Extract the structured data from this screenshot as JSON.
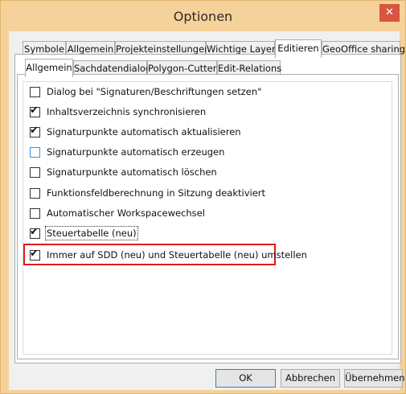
{
  "window": {
    "title": "Optionen",
    "close_glyph": "✕"
  },
  "tabs_top": [
    "Symbole",
    "Allgemein",
    "Projekteinstellungen",
    "Wichtige Layer",
    "Editieren",
    "GeoOffice sharing"
  ],
  "tabs_top_selected": "Editieren",
  "tabs_sub": [
    "Allgemein",
    "Sachdatendialog",
    "Polygon-Cutter",
    "Edit-Relations"
  ],
  "tabs_sub_selected": "Allgemein",
  "options": [
    {
      "label": "Dialog bei \"Signaturen/Beschriftungen setzen\"",
      "checked": false
    },
    {
      "label": "Inhaltsverzeichnis synchronisieren",
      "checked": true
    },
    {
      "label": "Signaturpunkte automatisch aktualisieren",
      "checked": true
    },
    {
      "label": "Signaturpunkte automatisch erzeugen",
      "checked": false
    },
    {
      "label": "Signaturpunkte automatisch löschen",
      "checked": false
    },
    {
      "label": "Funktionsfeldberechnung in Sitzung deaktiviert",
      "checked": false
    },
    {
      "label": "Automatischer Workspacewechsel",
      "checked": false
    },
    {
      "label": "Steuertabelle (neu)",
      "checked": true
    },
    {
      "label": "Immer auf SDD (neu) und Steuertabelle (neu) umstellen",
      "checked": true
    }
  ],
  "buttons": {
    "ok": "OK",
    "cancel": "Abbrechen",
    "apply": "Übernehmen"
  },
  "colors": {
    "frame": "#f6d29b",
    "close": "#d8553f",
    "highlight": "#e01b1b"
  }
}
